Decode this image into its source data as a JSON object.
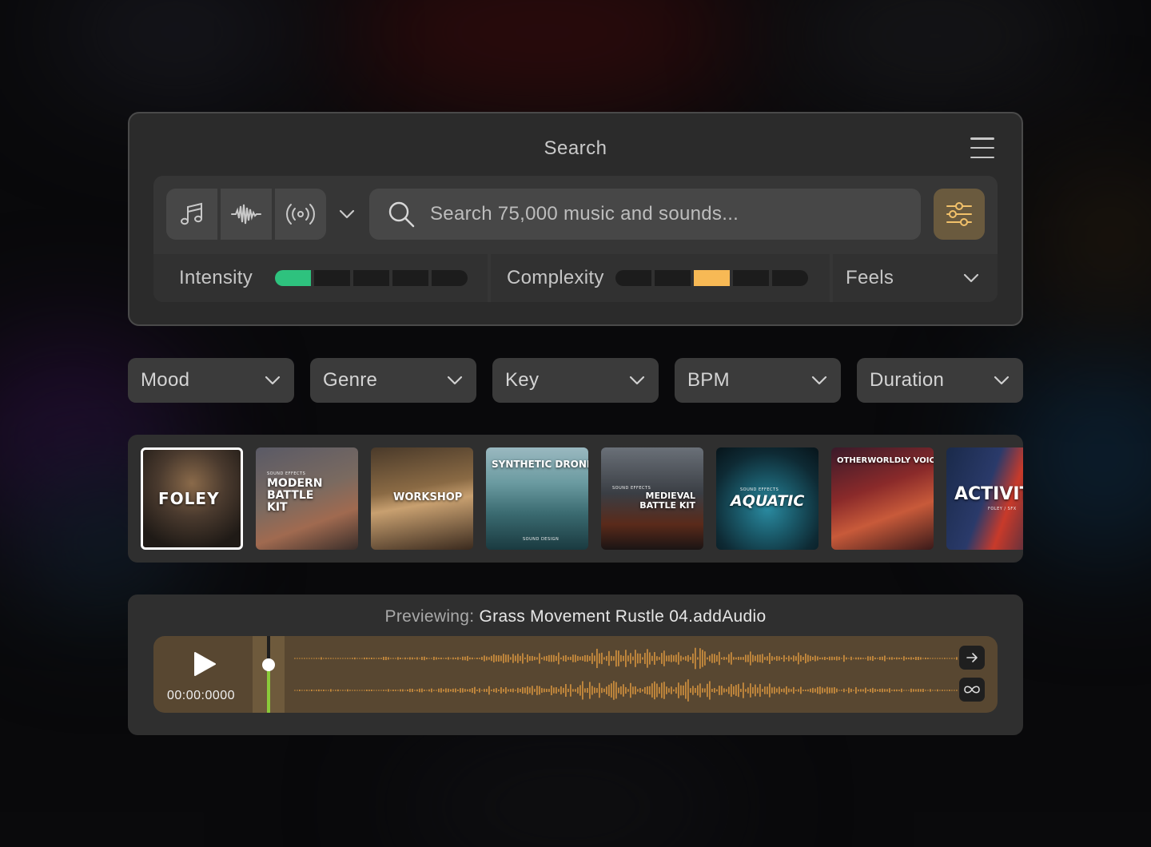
{
  "search": {
    "title": "Search",
    "placeholder": "Search 75,000 music and sounds...",
    "type_buttons": [
      {
        "icon": "music-note-icon"
      },
      {
        "icon": "waveform-icon"
      },
      {
        "icon": "broadcast-icon"
      }
    ],
    "filter_icon": "sliders-icon",
    "intensity": {
      "label": "Intensity",
      "segments": 5,
      "active": 1,
      "color": "#2ec27e"
    },
    "complexity": {
      "label": "Complexity",
      "segments": 5,
      "active": 3,
      "color": "#f7b955"
    },
    "feels": {
      "label": "Feels"
    }
  },
  "filters": [
    {
      "label": "Mood"
    },
    {
      "label": "Genre"
    },
    {
      "label": "Key"
    },
    {
      "label": "BPM"
    },
    {
      "label": "Duration"
    }
  ],
  "covers": [
    {
      "title": "FOLEY",
      "subtitle": "",
      "selected": true
    },
    {
      "title": "MODERN BATTLE KIT",
      "subtitle": "SOUND EFFECTS",
      "selected": false
    },
    {
      "title": "WORKSHOP",
      "subtitle": "",
      "selected": false
    },
    {
      "title": "SYNTHETIC DRONES",
      "subtitle": "SOUND DESIGN",
      "selected": false
    },
    {
      "title": "MEDIEVAL BATTLE KIT",
      "subtitle": "SOUND EFFECTS",
      "selected": false
    },
    {
      "title": "AQUATIC",
      "subtitle": "SOUND EFFECTS",
      "selected": false
    },
    {
      "title": "OTHERWORLDLY VOICES",
      "subtitle": "",
      "selected": false
    },
    {
      "title": "ACTIVIT",
      "subtitle": "FOLEY / SFX",
      "selected": false
    }
  ],
  "player": {
    "prefix": "Previewing:",
    "filename": "Grass Movement Rustle 04.addAudio",
    "timecode": "00:00:0000",
    "progress": 0,
    "wave_color": "#c68a3c",
    "buttons": [
      {
        "icon": "arrow-right-icon"
      },
      {
        "icon": "loop-icon"
      }
    ]
  }
}
